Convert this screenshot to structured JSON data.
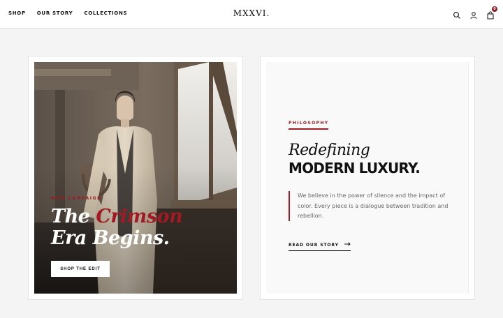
{
  "header": {
    "nav": [
      "SHOP",
      "OUR STORY",
      "COLLECTIONS"
    ],
    "logo": "MXXVI.",
    "cart_count": "0",
    "icons": [
      "search-icon",
      "user-icon",
      "shopping-bag-icon"
    ]
  },
  "campaign": {
    "eyebrow": "NEW CAMPAIGN",
    "title_line1_start": "The ",
    "title_line1_accent": "Crimson",
    "title_line2": "Era Begins.",
    "cta": "SHOP THE EDIT"
  },
  "philosophy": {
    "label": "PHILOSOPHY",
    "title_italic": "Redefining",
    "title_bold": "MODERN LUXURY.",
    "quote": "We believe in the power of silence and the impact of color. Every piece is a dialogue between tradition and rebellion.",
    "link": "READ OUR STORY"
  },
  "colors": {
    "accent": "#9b1c22",
    "background": "#f4f4f4",
    "text": "#111111"
  }
}
